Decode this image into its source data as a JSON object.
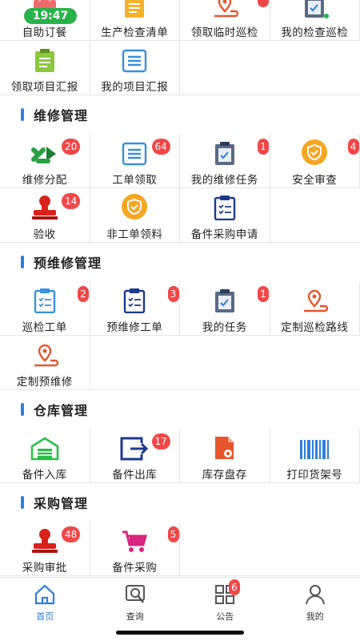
{
  "status": {
    "time": "19:47"
  },
  "top_rows": [
    [
      {
        "label": "自助订餐",
        "icon": "food-order-icon"
      },
      {
        "label": "生产检查清单",
        "icon": "checklist-icon"
      },
      {
        "label": "领取临时巡检",
        "icon": "route-pin-icon",
        "badge": ""
      },
      {
        "label": "我的检查巡检",
        "icon": "clipboard-check-icon"
      }
    ],
    [
      {
        "label": "领取项目汇报",
        "icon": "clipboard-list-green-icon"
      },
      {
        "label": "我的项目汇报",
        "icon": "document-list-icon"
      }
    ]
  ],
  "sections": [
    {
      "title": "维修管理",
      "rows": [
        [
          {
            "label": "维修分配",
            "icon": "distribute-arrows-icon",
            "badge": "20"
          },
          {
            "label": "工单领取",
            "icon": "document-list-icon",
            "badge": "64"
          },
          {
            "label": "我的维修任务",
            "icon": "clipboard-check-icon",
            "badge": "1"
          },
          {
            "label": "安全审查",
            "icon": "shield-check-icon",
            "badge": "4"
          }
        ],
        [
          {
            "label": "验收",
            "icon": "stamp-icon",
            "badge": "14"
          },
          {
            "label": "非工单领料",
            "icon": "shield-check-icon"
          },
          {
            "label": "备件采购申请",
            "icon": "clipboard-list-navy-icon"
          }
        ]
      ]
    },
    {
      "title": "预维修管理",
      "rows": [
        [
          {
            "label": "巡检工单",
            "icon": "clipboard-list-blue-icon",
            "badge": "2"
          },
          {
            "label": "预维修工单",
            "icon": "clipboard-list-navy-icon",
            "badge": "3"
          },
          {
            "label": "我的任务",
            "icon": "clipboard-check-icon",
            "badge": "1"
          },
          {
            "label": "定制巡检路线",
            "icon": "route-pin-icon"
          }
        ],
        [
          {
            "label": "定制预维修",
            "icon": "route-pin-icon"
          }
        ]
      ]
    },
    {
      "title": "仓库管理",
      "rows": [
        [
          {
            "label": "备件入库",
            "icon": "warehouse-icon"
          },
          {
            "label": "备件出库",
            "icon": "export-icon",
            "badge": "17"
          },
          {
            "label": "库存盘存",
            "icon": "inventory-doc-icon"
          },
          {
            "label": "打印货架号",
            "icon": "barcode-icon"
          }
        ]
      ]
    },
    {
      "title": "采购管理",
      "rows": [
        [
          {
            "label": "采购审批",
            "icon": "stamp-icon",
            "badge": "48"
          },
          {
            "label": "备件采购",
            "icon": "shopping-cart-icon",
            "badge": "5"
          }
        ]
      ]
    }
  ],
  "tabbar": [
    {
      "label": "首页",
      "icon": "home-icon",
      "active": true
    },
    {
      "label": "查询",
      "icon": "search-icon"
    },
    {
      "label": "公告",
      "icon": "grid-icon",
      "badge": "6"
    },
    {
      "label": "我的",
      "icon": "user-icon"
    }
  ],
  "colors": {
    "accent": "#2f7ee0",
    "badge": "#f04848",
    "green": "#28b34a"
  }
}
